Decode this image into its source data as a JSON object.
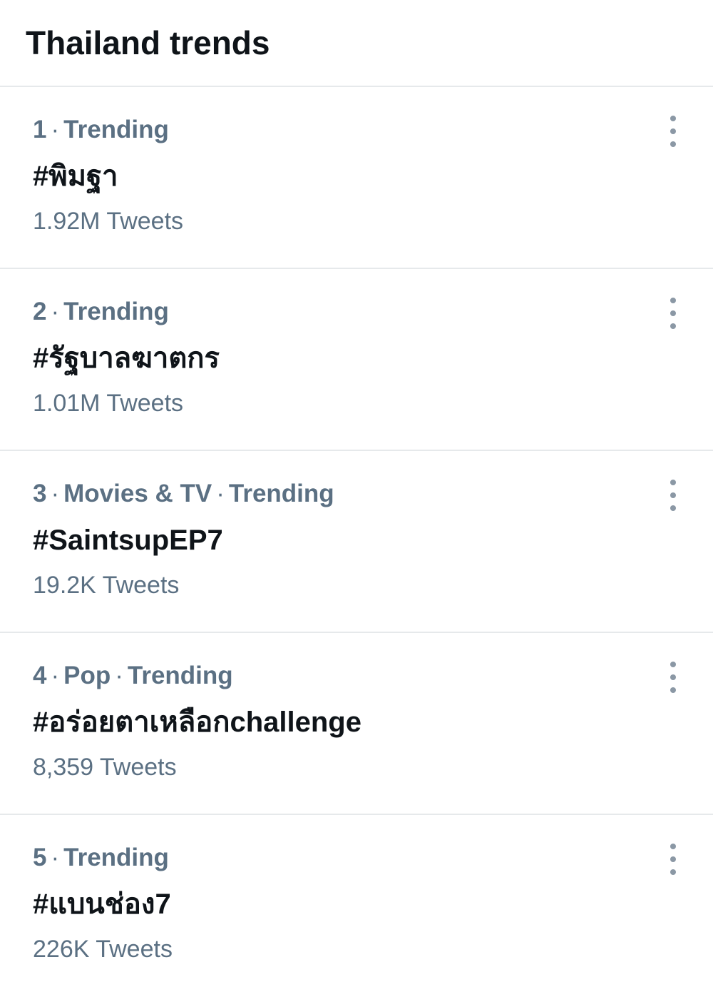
{
  "header": {
    "title": "Thailand trends"
  },
  "separator": "·",
  "trends": [
    {
      "rank": "1",
      "category": "",
      "status": "Trending",
      "name": "#พิมฐา",
      "count": "1.92M Tweets",
      "more_icon": "more-vertical-icon"
    },
    {
      "rank": "2",
      "category": "",
      "status": "Trending",
      "name": "#รัฐบาลฆาตกร",
      "count": "1.01M Tweets",
      "more_icon": "more-vertical-icon"
    },
    {
      "rank": "3",
      "category": "Movies & TV",
      "status": "Trending",
      "name": "#SaintsupEP7",
      "count": "19.2K Tweets",
      "more_icon": "more-vertical-icon"
    },
    {
      "rank": "4",
      "category": "Pop",
      "status": "Trending",
      "name": "#อร่อยตาเหลือกchallenge",
      "count": "8,359 Tweets",
      "more_icon": "more-vertical-icon"
    },
    {
      "rank": "5",
      "category": "",
      "status": "Trending",
      "name": "#แบนช่อง7",
      "count": "226K Tweets",
      "more_icon": "more-vertical-icon"
    }
  ],
  "colors": {
    "primary_text": "#0f1419",
    "secondary_text": "#5b7083",
    "divider": "#e6e9eb",
    "icon": "#8b98a5"
  }
}
